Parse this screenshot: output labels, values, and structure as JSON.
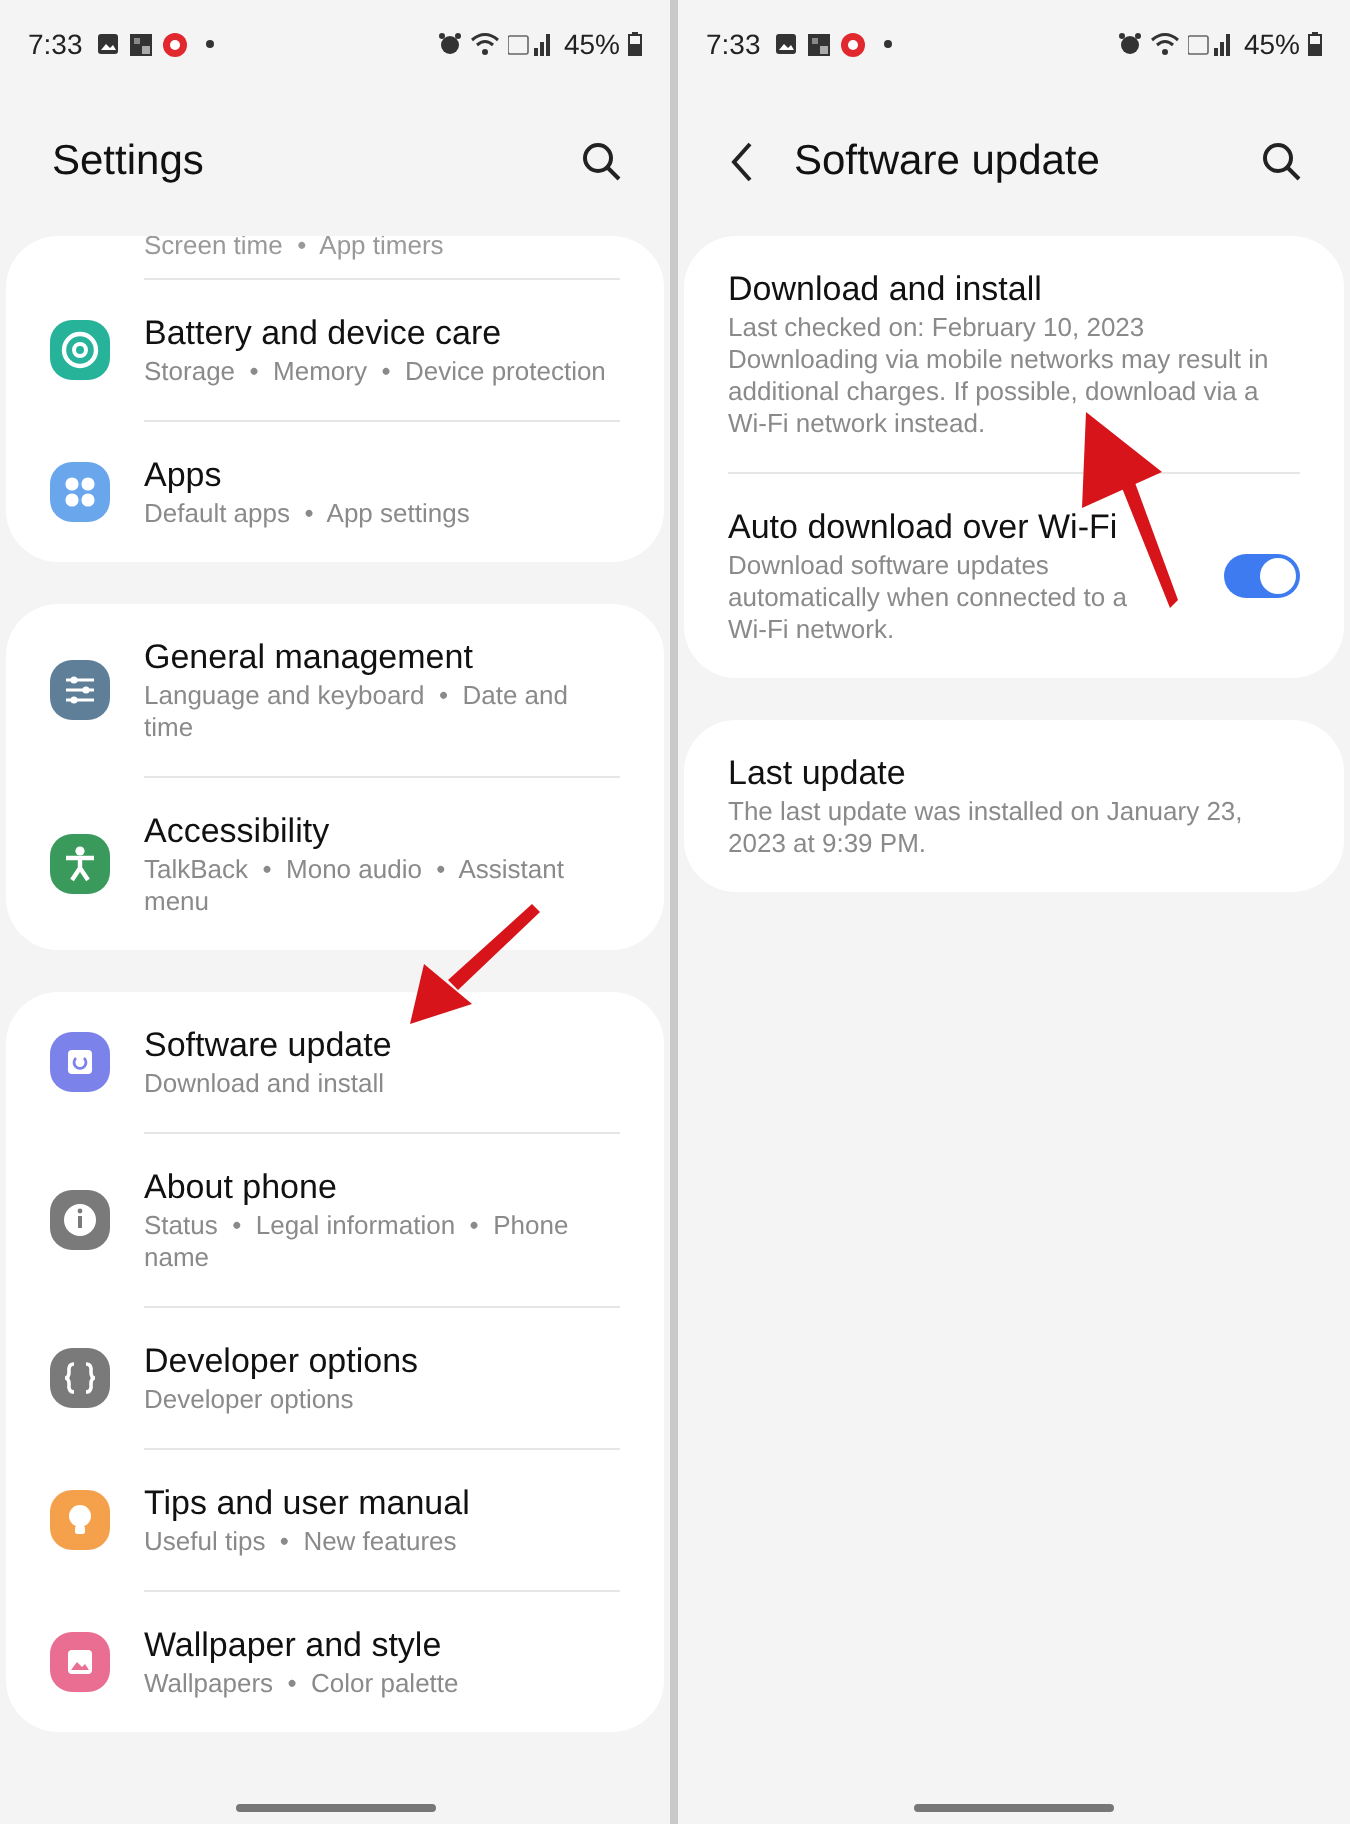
{
  "screens": [
    {
      "status_bar": {
        "time": "7:33",
        "battery": "45%"
      },
      "header": {
        "title": "Settings",
        "back": false
      },
      "sections": [
        {
          "partial": "Screen time  •  App timers",
          "items": [
            {
              "title": "Battery and device care",
              "subtitle": "Storage  •  Memory  •  Device protection",
              "color": "#26b39a"
            },
            {
              "title": "Apps",
              "subtitle": "Default apps  •  App settings",
              "color": "#6aa6ec"
            }
          ]
        },
        {
          "items": [
            {
              "title": "General management",
              "subtitle": "Language and keyboard  •  Date and time",
              "color": "#5f7f99"
            },
            {
              "title": "Accessibility",
              "subtitle": "TalkBack  •  Mono audio  •  Assistant menu",
              "color": "#3a9a5c"
            }
          ]
        },
        {
          "items": [
            {
              "title": "Software update",
              "subtitle": "Download and install",
              "color": "#7b83ea"
            },
            {
              "title": "About phone",
              "subtitle": "Status  •  Legal information  •  Phone name",
              "color": "#7a7a7a"
            },
            {
              "title": "Developer options",
              "subtitle": "Developer options",
              "color": "#7a7a7a"
            },
            {
              "title": "Tips and user manual",
              "subtitle": "Useful tips  •  New features",
              "color": "#f5a04a"
            },
            {
              "title": "Wallpaper and style",
              "subtitle": "Wallpapers  •  Color palette",
              "color": "#ea6d92"
            }
          ]
        }
      ]
    },
    {
      "status_bar": {
        "time": "7:33",
        "battery": "45%"
      },
      "header": {
        "title": "Software update",
        "back": true
      },
      "sections": [
        {
          "items": [
            {
              "kind": "plain",
              "title": "Download and install",
              "subtitle": "Last checked on: February 10, 2023 Downloading via mobile networks may result in additional charges. If possible, download via a Wi-Fi network instead."
            },
            {
              "kind": "toggle",
              "title": "Auto download over Wi-Fi",
              "subtitle": "Download software updates automatically when connected to a Wi-Fi network.",
              "on": true
            }
          ]
        },
        {
          "items": [
            {
              "kind": "plain",
              "title": "Last update",
              "subtitle": "The last update was installed on January 23, 2023 at 9:39 PM."
            }
          ]
        }
      ]
    }
  ]
}
